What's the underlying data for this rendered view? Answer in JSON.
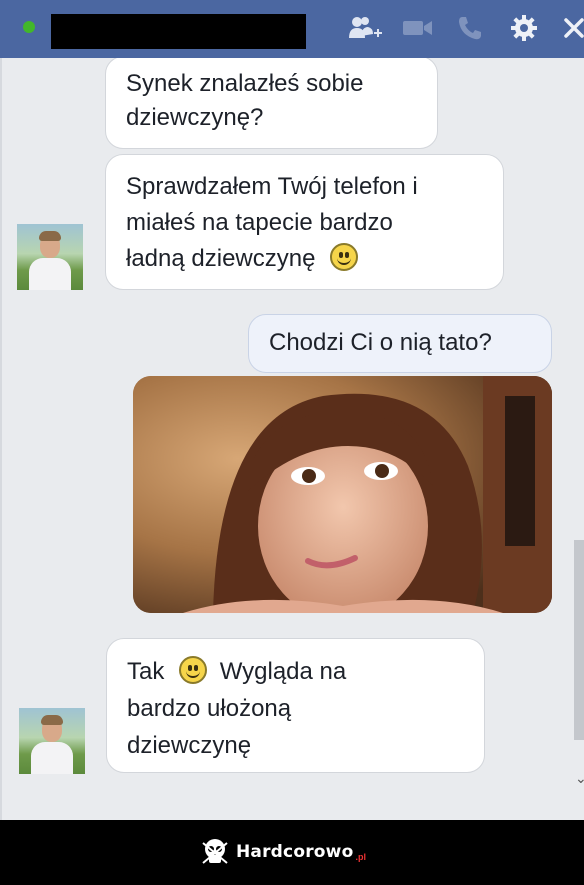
{
  "header": {
    "online_color": "#42b72a",
    "icons": [
      "add-friend-icon",
      "video-call-icon",
      "phone-icon",
      "gear-icon",
      "close-icon"
    ]
  },
  "messages": [
    {
      "from": "other",
      "parts": [
        "Synek znalazłeś sobie dziewczynę?"
      ]
    },
    {
      "from": "other",
      "parts": [
        "Sprawdzałem Twój telefon i miałeś na tapecie bardzo ładną dziewczynę"
      ],
      "emoji_after": true
    },
    {
      "from": "me",
      "parts": [
        "Chodzi Ci o nią tato?"
      ]
    },
    {
      "from": "me",
      "type": "photo"
    },
    {
      "from": "other",
      "parts": [
        "Tak",
        "Wygląda na bardzo ułożoną dziewczynę"
      ],
      "emoji_between": true
    }
  ],
  "msg1_line1": "Synek znalazłeś sobie",
  "msg1_line2": "dziewczynę?",
  "msg2_line1": "Sprawdzałem Twój telefon i",
  "msg2_line2": "miałeś na tapecie bardzo",
  "msg2_line3": "ładną dziewczynę",
  "msg3": "Chodzi Ci o nią tato?",
  "msg4_a": "Tak",
  "msg4_b": "Wygląda na",
  "msg4_line2": "bardzo ułożoną",
  "msg4_line3": "dziewczynę",
  "watermark": {
    "text": "Hardcorowo",
    "suffix": ".pl"
  }
}
